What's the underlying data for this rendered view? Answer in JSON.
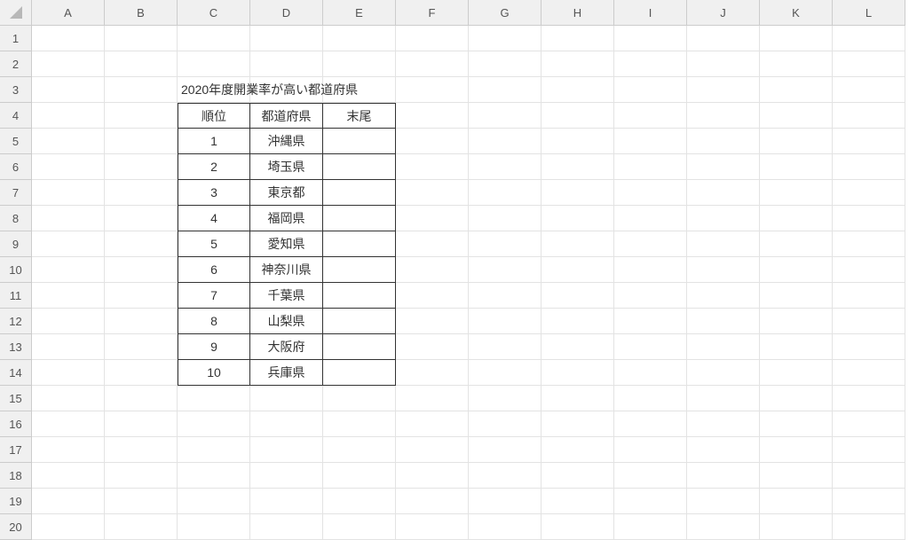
{
  "columns": [
    "A",
    "B",
    "C",
    "D",
    "E",
    "F",
    "G",
    "H",
    "I",
    "J",
    "K",
    "L"
  ],
  "rows": [
    "1",
    "2",
    "3",
    "4",
    "5",
    "6",
    "7",
    "8",
    "9",
    "10",
    "11",
    "12",
    "13",
    "14",
    "15",
    "16",
    "17",
    "18",
    "19",
    "20"
  ],
  "title_cell": "2020年度開業率が高い都道府県",
  "headers": {
    "c": "順位",
    "d": "都道府県",
    "e": "末尾"
  },
  "data": [
    {
      "rank": "1",
      "pref": "沖縄県",
      "tail": ""
    },
    {
      "rank": "2",
      "pref": "埼玉県",
      "tail": ""
    },
    {
      "rank": "3",
      "pref": "東京都",
      "tail": ""
    },
    {
      "rank": "4",
      "pref": "福岡県",
      "tail": ""
    },
    {
      "rank": "5",
      "pref": "愛知県",
      "tail": ""
    },
    {
      "rank": "6",
      "pref": "神奈川県",
      "tail": ""
    },
    {
      "rank": "7",
      "pref": "千葉県",
      "tail": ""
    },
    {
      "rank": "8",
      "pref": "山梨県",
      "tail": ""
    },
    {
      "rank": "9",
      "pref": "大阪府",
      "tail": ""
    },
    {
      "rank": "10",
      "pref": "兵庫県",
      "tail": ""
    }
  ]
}
